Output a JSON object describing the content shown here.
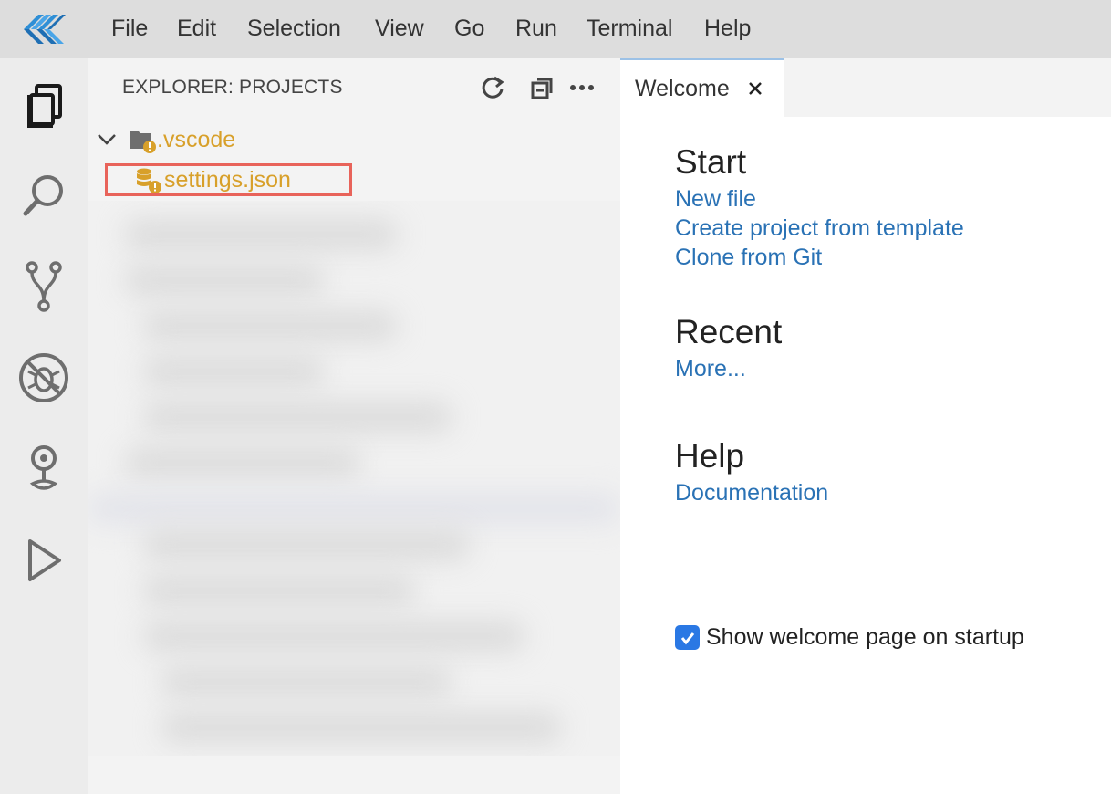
{
  "menu": {
    "items": [
      "File",
      "Edit",
      "Selection",
      "View",
      "Go",
      "Run",
      "Terminal",
      "Help"
    ]
  },
  "activity_bar": {
    "icons": [
      "files-icon",
      "search-icon",
      "source-control-icon",
      "no-debug-icon",
      "remote-icon",
      "run-icon"
    ]
  },
  "explorer": {
    "title": "EXPLORER: PROJECTS",
    "tree": [
      {
        "label": ".vscode",
        "type": "folder",
        "expanded": true
      },
      {
        "label": "settings.json",
        "type": "file"
      }
    ]
  },
  "editor": {
    "tab_label": "Welcome",
    "sections": {
      "start": {
        "heading": "Start",
        "links": [
          "New file",
          "Create project from template",
          "Clone from Git"
        ]
      },
      "recent": {
        "heading": "Recent",
        "links": [
          "More..."
        ]
      },
      "help": {
        "heading": "Help",
        "links": [
          "Documentation"
        ]
      }
    },
    "startup_checkbox": {
      "label": "Show welcome page on startup",
      "checked": true
    }
  },
  "colors": {
    "link": "#2a72b5",
    "warning_file": "#d8a02a",
    "highlight_border": "#e8635a",
    "checkbox": "#2a78e4"
  }
}
